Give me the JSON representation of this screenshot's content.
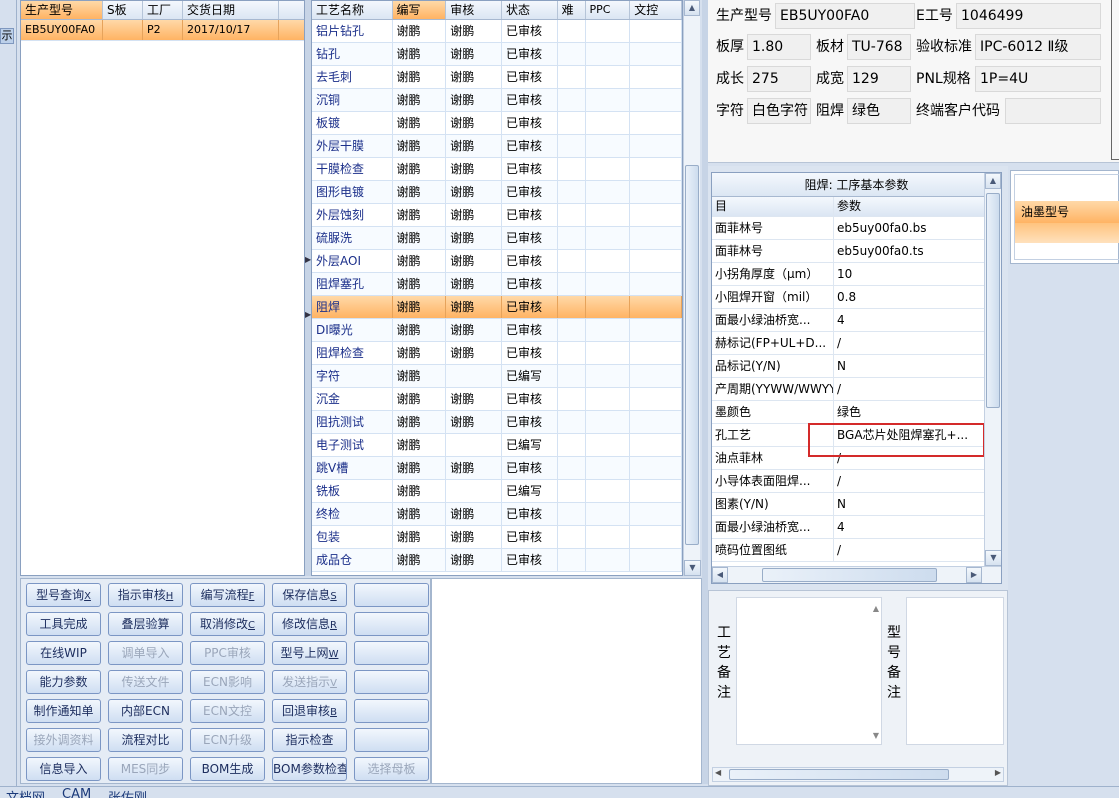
{
  "left_grid": {
    "headers": [
      "生产型号",
      "S板",
      "工厂",
      "交货日期"
    ],
    "rows": [
      {
        "model": "EB5UY00FA0",
        "s_board": "",
        "factory": "P2",
        "date": "2017/10/17"
      }
    ],
    "edge_label": "示"
  },
  "process_grid": {
    "headers": [
      "工艺名称",
      "编写",
      "审核",
      "状态",
      "难",
      "PPC",
      "文控"
    ],
    "rows": [
      {
        "name": "铝片钻孔",
        "writer": "谢鹏",
        "reviewer": "谢鹏",
        "status": "已审核"
      },
      {
        "name": "钻孔",
        "writer": "谢鹏",
        "reviewer": "谢鹏",
        "status": "已审核"
      },
      {
        "name": "去毛刺",
        "writer": "谢鹏",
        "reviewer": "谢鹏",
        "status": "已审核"
      },
      {
        "name": "沉铜",
        "writer": "谢鹏",
        "reviewer": "谢鹏",
        "status": "已审核"
      },
      {
        "name": "板镀",
        "writer": "谢鹏",
        "reviewer": "谢鹏",
        "status": "已审核"
      },
      {
        "name": "外层干膜",
        "writer": "谢鹏",
        "reviewer": "谢鹏",
        "status": "已审核"
      },
      {
        "name": "干膜检查",
        "writer": "谢鹏",
        "reviewer": "谢鹏",
        "status": "已审核"
      },
      {
        "name": "图形电镀",
        "writer": "谢鹏",
        "reviewer": "谢鹏",
        "status": "已审核"
      },
      {
        "name": "外层蚀刻",
        "writer": "谢鹏",
        "reviewer": "谢鹏",
        "status": "已审核"
      },
      {
        "name": "硫脲洗",
        "writer": "谢鹏",
        "reviewer": "谢鹏",
        "status": "已审核"
      },
      {
        "name": "外层AOI",
        "writer": "谢鹏",
        "reviewer": "谢鹏",
        "status": "已审核"
      },
      {
        "name": "阻焊塞孔",
        "writer": "谢鹏",
        "reviewer": "谢鹏",
        "status": "已审核"
      },
      {
        "name": "阻焊",
        "writer": "谢鹏",
        "reviewer": "谢鹏",
        "status": "已审核"
      },
      {
        "name": "DI曝光",
        "writer": "谢鹏",
        "reviewer": "谢鹏",
        "status": "已审核"
      },
      {
        "name": "阻焊检查",
        "writer": "谢鹏",
        "reviewer": "谢鹏",
        "status": "已审核"
      },
      {
        "name": "字符",
        "writer": "谢鹏",
        "reviewer": "",
        "status": "已编写"
      },
      {
        "name": "沉金",
        "writer": "谢鹏",
        "reviewer": "谢鹏",
        "status": "已审核"
      },
      {
        "name": "阻抗测试",
        "writer": "谢鹏",
        "reviewer": "谢鹏",
        "status": "已审核"
      },
      {
        "name": "电子测试",
        "writer": "谢鹏",
        "reviewer": "",
        "status": "已编写"
      },
      {
        "name": "跳V槽",
        "writer": "谢鹏",
        "reviewer": "谢鹏",
        "status": "已审核"
      },
      {
        "name": "铣板",
        "writer": "谢鹏",
        "reviewer": "",
        "status": "已编写"
      },
      {
        "name": "终检",
        "writer": "谢鹏",
        "reviewer": "谢鹏",
        "status": "已审核"
      },
      {
        "name": "包装",
        "writer": "谢鹏",
        "reviewer": "谢鹏",
        "status": "已审核"
      },
      {
        "name": "成品仓",
        "writer": "谢鹏",
        "reviewer": "谢鹏",
        "status": "已审核"
      }
    ],
    "selected_index": 12
  },
  "info": {
    "model_label": "生产型号",
    "model": "EB5UY00FA0",
    "eno_label": "E工号",
    "eno": "1046499",
    "thickness_label": "板厚",
    "thickness": "1.80",
    "material_label": "板材",
    "material": "TU-768",
    "standard_label": "验收标准",
    "standard": "IPC-6012 Ⅱ级",
    "length_label": "成长",
    "length": "275",
    "width_label": "成宽",
    "width": "129",
    "pnl_label": "PNL规格",
    "pnl": "1P=4U",
    "char_label": "字符",
    "char": "白色字符",
    "mask_label": "阻焊",
    "mask": "绿色",
    "customer_label": "终端客户代码",
    "customer": ""
  },
  "params": {
    "title": "阻焊: 工序基本参数",
    "col_item": "目",
    "col_param": "参数",
    "rows": [
      {
        "k": "面菲林号",
        "v": "eb5uy00fa0.bs"
      },
      {
        "k": "面菲林号",
        "v": "eb5uy00fa0.ts"
      },
      {
        "k": "小拐角厚度（μm）",
        "v": "10"
      },
      {
        "k": "小阻焊开窗（mil）",
        "v": "0.8"
      },
      {
        "k": "面最小绿油桥宽...",
        "v": "4"
      },
      {
        "k": "赫标记(FP+UL+D...",
        "v": "/"
      },
      {
        "k": "品标记(Y/N)",
        "v": "N"
      },
      {
        "k": "产周期(YYWW/WWYY)",
        "v": "/"
      },
      {
        "k": "墨颜色",
        "v": "绿色"
      },
      {
        "k": "孔工艺",
        "v": "BGA芯片处阻焊塞孔+..."
      },
      {
        "k": "油点菲林",
        "v": "/"
      },
      {
        "k": "小导体表面阻焊...",
        "v": "/"
      },
      {
        "k": "图素(Y/N)",
        "v": "N"
      },
      {
        "k": "面最小绿油桥宽...",
        "v": "4"
      },
      {
        "k": "喷码位置图纸",
        "v": "/"
      }
    ]
  },
  "ink": {
    "header": "油墨型号"
  },
  "remarks": {
    "process": "工艺备注",
    "model": "型号备注"
  },
  "buttons": {
    "r1": [
      "型号查询",
      "指示审核",
      "编写流程",
      "保存信息",
      ""
    ],
    "r1k": [
      "X",
      "H",
      "F",
      "S",
      ""
    ],
    "r2": [
      "工具完成",
      "叠层验算",
      "取消修改",
      "修改信息",
      ""
    ],
    "r2k": [
      "",
      "",
      "C",
      "R",
      ""
    ],
    "r3": [
      "在线WIP",
      "调单导入",
      "PPC审核",
      "型号上网",
      ""
    ],
    "r3k": [
      "",
      "",
      "",
      "W",
      ""
    ],
    "r4": [
      "能力参数",
      "传送文件",
      "ECN影响",
      "发送指示",
      ""
    ],
    "r4k": [
      "",
      "",
      "",
      "V",
      ""
    ],
    "r5": [
      "制作通知单",
      "内部ECN",
      "ECN文控",
      "回退审核",
      ""
    ],
    "r5k": [
      "",
      "",
      "",
      "B",
      ""
    ],
    "r6": [
      "接外调资料",
      "流程对比",
      "ECN升级",
      "指示检查",
      ""
    ],
    "r7": [
      "信息导入",
      "MES同步",
      "BOM生成",
      "BOM参数检查",
      "选择母板"
    ]
  },
  "tabs": [
    "文档网",
    "CAM",
    "张佐刚"
  ]
}
